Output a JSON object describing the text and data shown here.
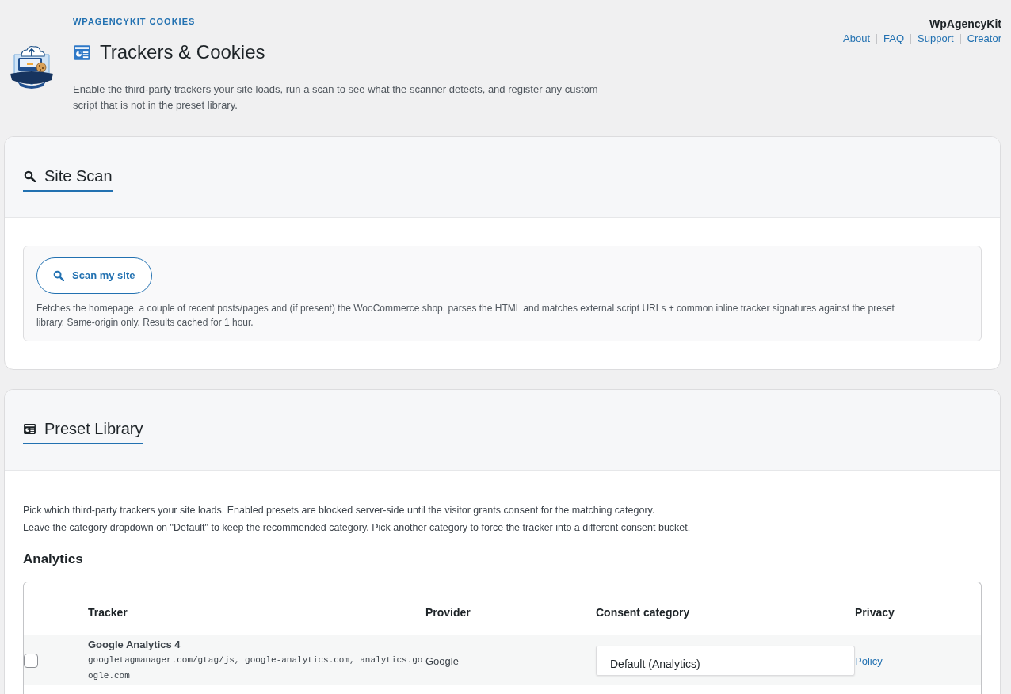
{
  "header": {
    "plugin_label": "WPAGENCYKIT COOKIES",
    "title": "Trackers & Cookies",
    "description": "Enable the third-party trackers your site loads, run a scan to see what the scanner detects, and register any custom script that is not in the preset library.",
    "brand": "WpAgencyKit",
    "links": [
      {
        "label": "About"
      },
      {
        "label": "FAQ"
      },
      {
        "label": "Support"
      },
      {
        "label": "Creator"
      }
    ]
  },
  "sections": [
    {
      "kind": "scan",
      "title": "Site Scan",
      "button": "Scan my site",
      "note": "Fetches the homepage, a couple of recent posts/pages and (if present) the WooCommerce shop, parses the HTML and matches external script URLs + common inline tracker signatures against the preset library. Same-origin only. Results cached for 1 hour."
    },
    {
      "kind": "presets",
      "title": "Preset Library",
      "intro": [
        "Pick which third-party trackers your site loads. Enabled presets are blocked server-side until the visitor grants consent for the matching category.",
        "Leave the category dropdown on \"Default\" to keep the recommended category. Pick another category to force the tracker into a different consent bucket."
      ],
      "groups": [
        {
          "title": "Analytics",
          "table": {
            "columns": [
              "Tracker",
              "Provider",
              "Consent category",
              "Privacy"
            ],
            "rows": [
              {
                "checked": false,
                "name": "Google Analytics 4",
                "domains": "googletagmanager.com/gtag/js, google-analytics.com, analytics.google.com",
                "provider": "Google",
                "category": "Default (Analytics)",
                "privacy": "Policy"
              }
            ]
          }
        }
      ]
    }
  ]
}
